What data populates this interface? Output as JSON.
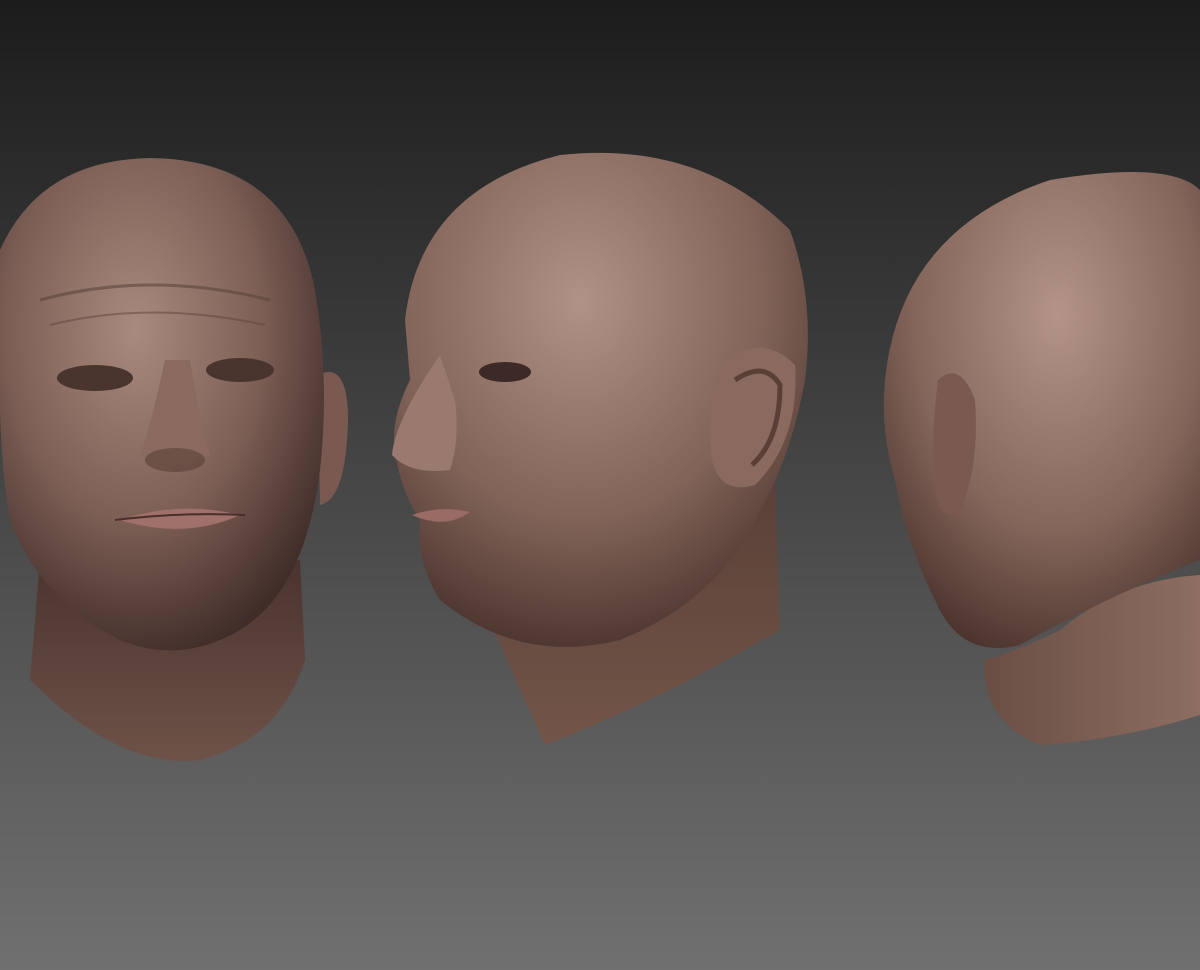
{
  "scene": {
    "description_free": true,
    "background": {
      "top_color": "#1c1c1c",
      "bottom_color": "#6e6e6e"
    },
    "skin": {
      "base": "#8a6a5e",
      "highlight": "#a88a7e",
      "shadow": "#3d2a26",
      "lip": "#a0706a"
    },
    "views": [
      {
        "icon": "head-front-view-icon"
      },
      {
        "icon": "head-three-quarter-view-icon"
      },
      {
        "icon": "head-back-view-icon"
      }
    ]
  }
}
